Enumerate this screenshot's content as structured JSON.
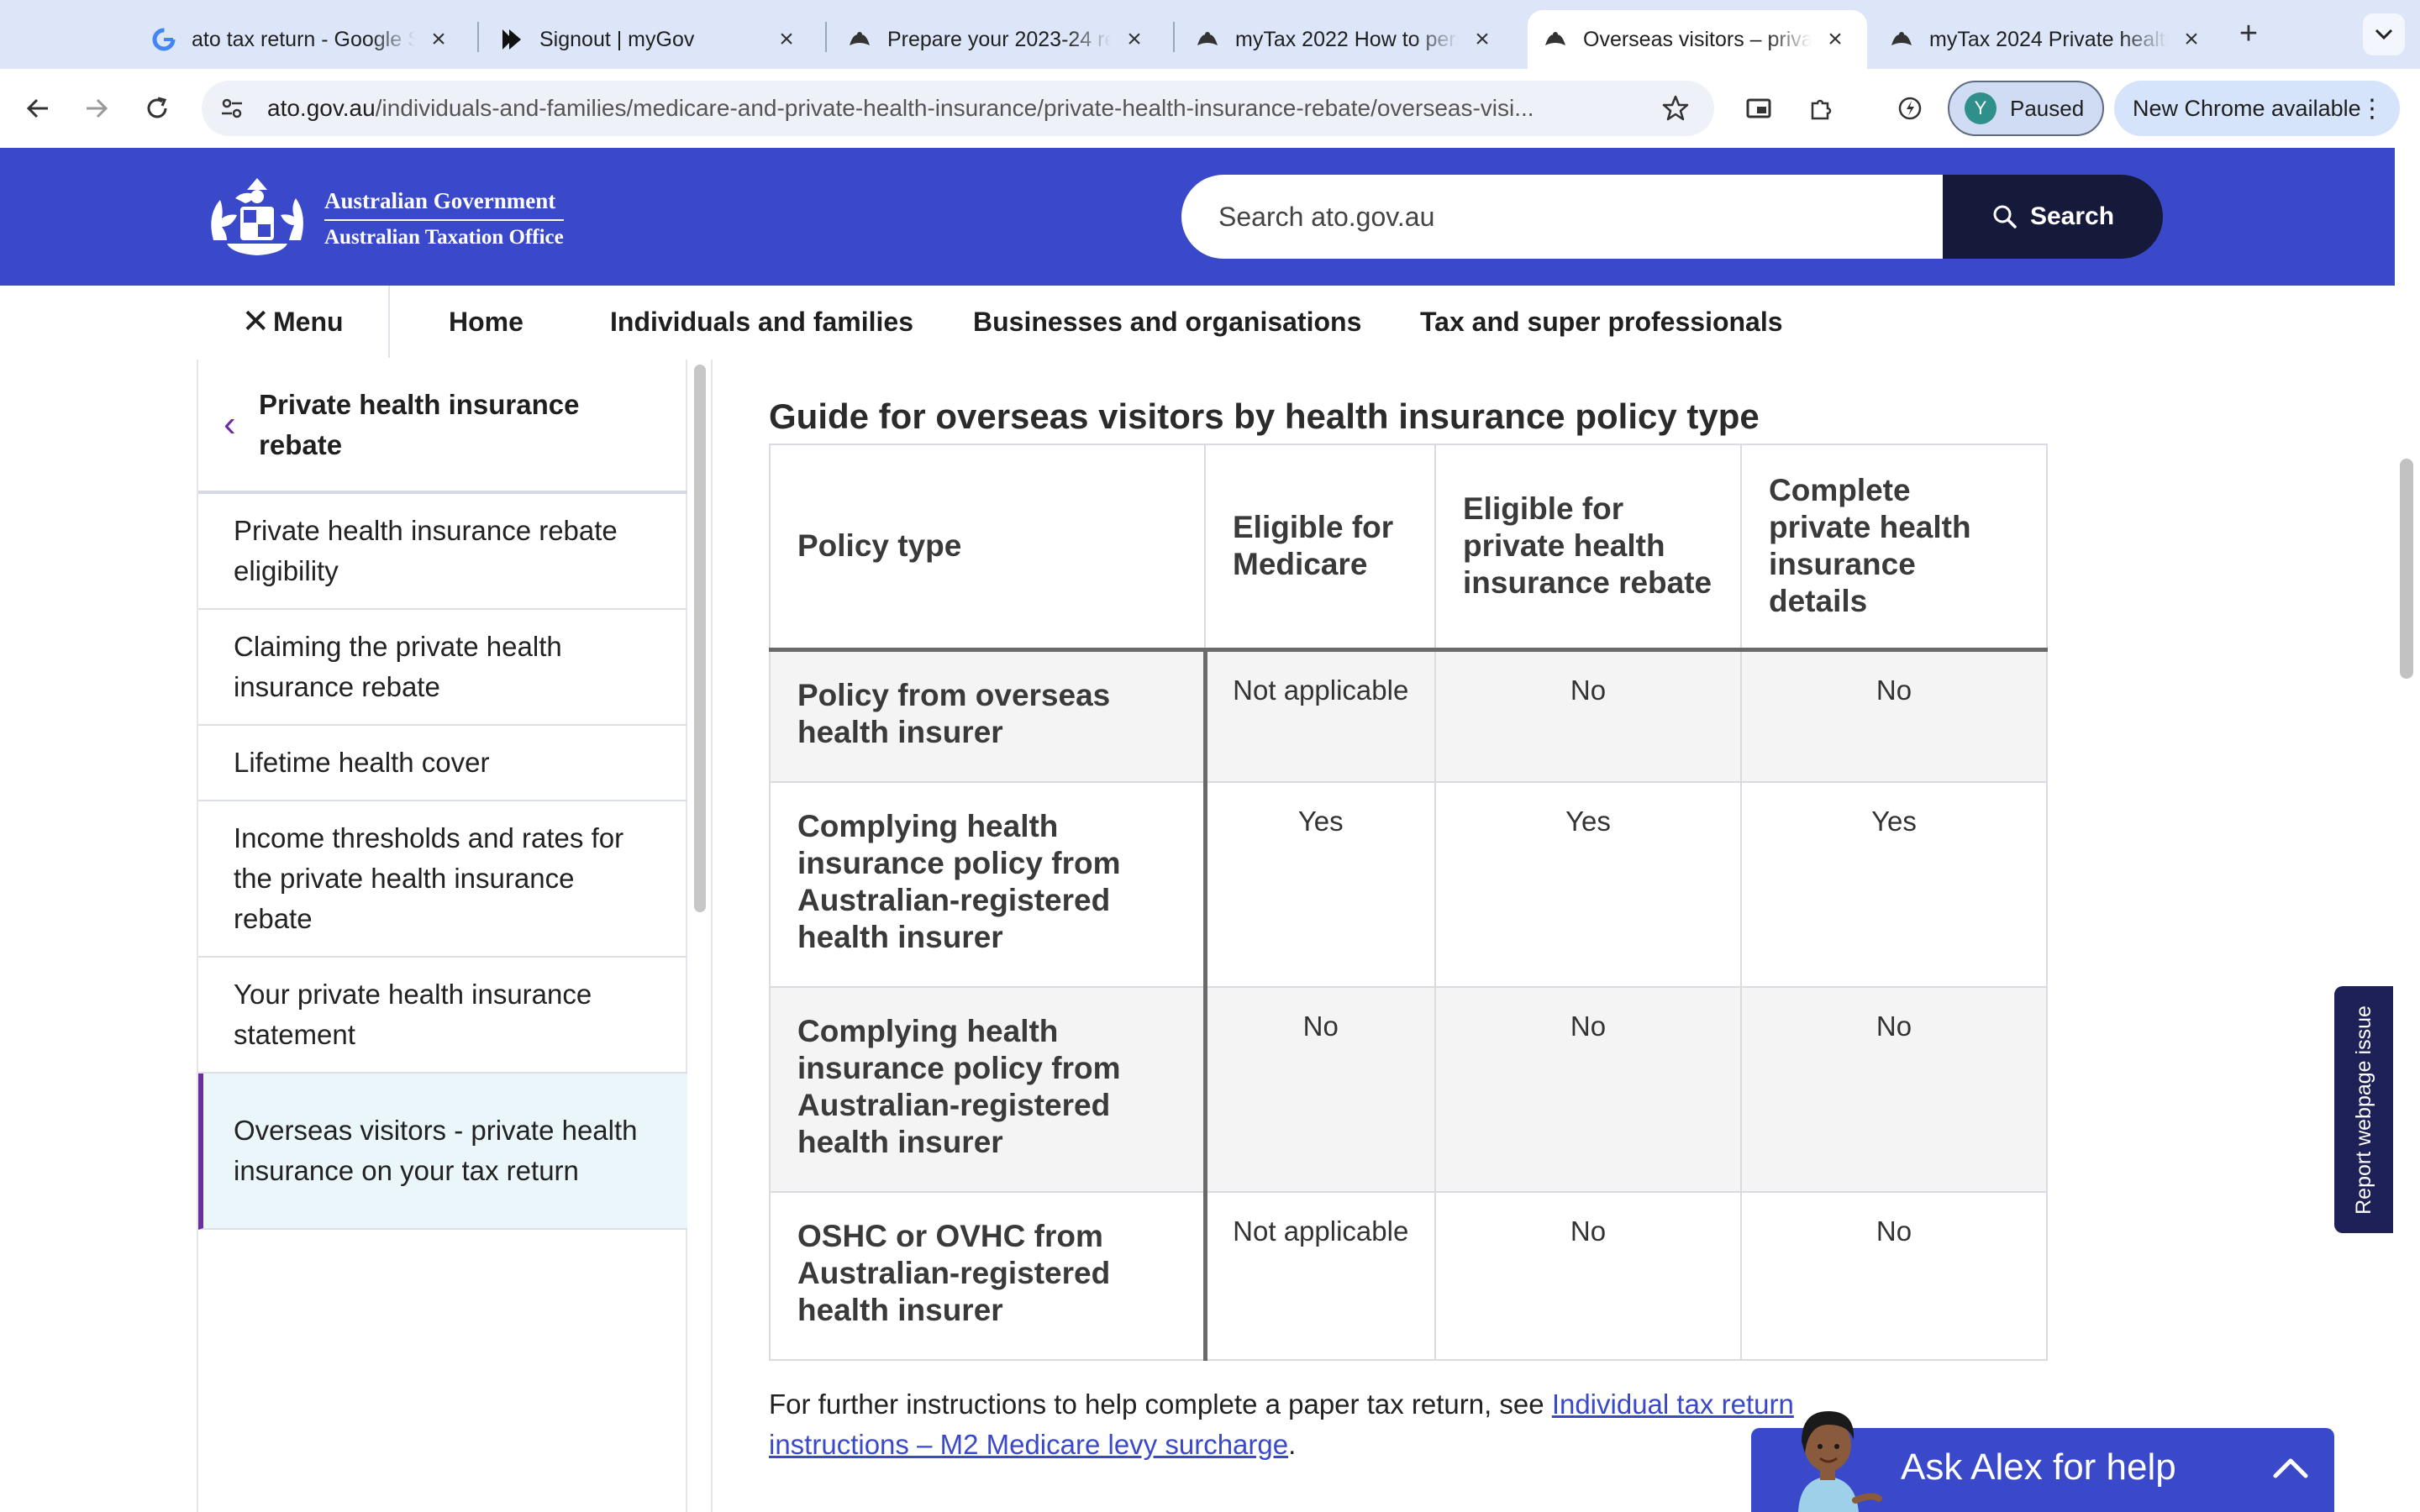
{
  "browser": {
    "tabs": [
      {
        "title": "ato tax return - Google Search",
        "icon": "google-g-icon"
      },
      {
        "title": "Signout | myGov",
        "icon": "mygov-icon"
      },
      {
        "title": "Prepare your 2023-24 return",
        "icon": "ato-crest-icon"
      },
      {
        "title": "myTax 2022 How to personalise",
        "icon": "ato-crest-icon"
      },
      {
        "title": "Overseas visitors – private",
        "icon": "ato-crest-icon",
        "active": true
      },
      {
        "title": "myTax 2024 Private health",
        "icon": "ato-crest-icon"
      }
    ],
    "address": {
      "host": "ato.gov.au",
      "path": "/individuals-and-families/medicare-and-private-health-insurance/private-health-insurance-rebate/overseas-visi..."
    },
    "profile": {
      "initial": "Y",
      "label": "Paused"
    },
    "update_label": "New Chrome available"
  },
  "site": {
    "logo": {
      "line1": "Australian Government",
      "line2": "Australian Taxation Office"
    },
    "search": {
      "placeholder": "Search ato.gov.au",
      "button": "Search"
    },
    "nav": {
      "menu": "Menu",
      "items": [
        "Home",
        "Individuals and families",
        "Businesses and organisations",
        "Tax and super professionals"
      ]
    },
    "sidebar": {
      "parent": "Private health insurance rebate",
      "items": [
        "Private health insurance rebate eligibility",
        "Claiming the private health insurance rebate",
        "Lifetime health cover",
        "Income thresholds and rates for the private health insurance rebate",
        "Your private health insurance statement",
        "Overseas visitors - private health insurance on your tax return"
      ],
      "active_index": 5
    },
    "content": {
      "heading": "Guide for overseas visitors by health insurance policy type",
      "table": {
        "headers": [
          "Policy type",
          "Eligible for Medicare",
          "Eligible for private health insurance rebate",
          "Complete private health insurance details"
        ],
        "rows": [
          {
            "policy": "Policy from overseas health insurer",
            "cells": [
              "Not applicable",
              "No",
              "No"
            ]
          },
          {
            "policy": "Complying health insurance policy from Australian-registered health insurer",
            "cells": [
              "Yes",
              "Yes",
              "Yes"
            ]
          },
          {
            "policy": "Complying health insurance policy from Australian-registered health insurer",
            "cells": [
              "No",
              "No",
              "No"
            ]
          },
          {
            "policy": "OSHC or OVHC from Australian-registered health insurer",
            "cells": [
              "Not applicable",
              "No",
              "No"
            ]
          }
        ]
      },
      "footnote": {
        "text": "For further instructions to help complete a paper tax return, see ",
        "link": "Individual tax return instructions – M2 Medicare levy surcharge",
        "end": "."
      }
    },
    "report_tab": "Report webpage issue",
    "ask_alex": "Ask Alex for help"
  },
  "colors": {
    "header_blue": "#3a49c9",
    "accent_purple": "#6b2fa0",
    "dark_navy": "#151a3a"
  }
}
